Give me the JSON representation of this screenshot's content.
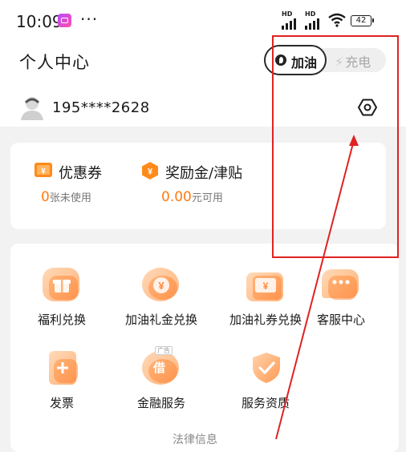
{
  "status_bar": {
    "time": "10:09",
    "dots": "···",
    "hd1": "HD",
    "hd2": "HD",
    "battery": "42"
  },
  "header": {
    "title": "个人中心",
    "toggle_active": "加油",
    "toggle_inactive": "充电"
  },
  "user": {
    "phone": "195****2628"
  },
  "coupon_card": {
    "coupon": {
      "label": "优惠券",
      "count": "0",
      "suffix": "张未使用"
    },
    "reward": {
      "label": "奖励金/津贴",
      "amount": "0.00",
      "suffix": "元可用"
    }
  },
  "services": [
    {
      "label": "福利兑换",
      "icon": "gift-icon"
    },
    {
      "label": "加油礼金兑换",
      "icon": "coin-yen-icon"
    },
    {
      "label": "加油礼券兑换",
      "icon": "voucher-yen-icon"
    },
    {
      "label": "客服中心",
      "icon": "chat-bubble-icon"
    },
    {
      "label": "发票",
      "icon": "invoice-plus-icon"
    },
    {
      "label": "金融服务",
      "icon": "loan-icon",
      "badge": "广告",
      "glyph": "借"
    },
    {
      "label": "服务资质",
      "icon": "shield-check-icon"
    }
  ],
  "footer_partial": "法律信息",
  "colors": {
    "accent": "#ff7a10",
    "annotation": "#e02222"
  }
}
